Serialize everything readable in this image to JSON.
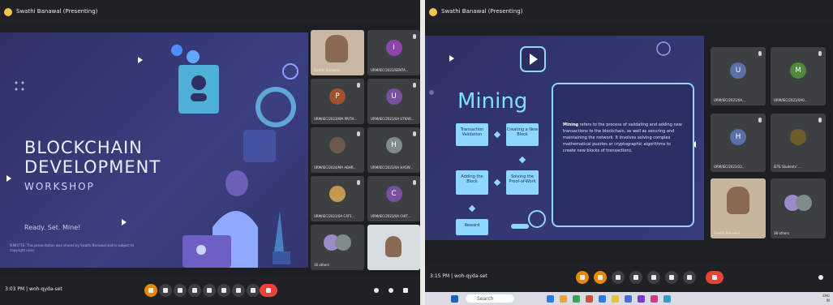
{
  "left": {
    "title": "Swathi Banawal (Presenting)",
    "slide": {
      "title_line1": "BLOCKCHAIN",
      "title_line2": "DEVELOPMENT",
      "title_line3": "WORKSHOP",
      "tagline": "Ready. Set. Mine!",
      "note": "IEMISTTE: This presentation was shared by Swathi Banawal and is subject to copyright rules."
    },
    "tiles": [
      {
        "name": "Swathi Banawal",
        "type": "video"
      },
      {
        "name": "URM/IEC/2023/SENTA...",
        "initial": "I",
        "color": "#8e44ad"
      },
      {
        "name": "URM/IEC/2023/WA PRITH...",
        "initial": "P",
        "color": "#a0522d"
      },
      {
        "name": "URM/IEC/2021/0A UTKAR...",
        "initial": "U",
        "color": "#7b4fa0"
      },
      {
        "name": "URM/IEC/2024/MA ABHR...",
        "type": "photo"
      },
      {
        "name": "URM/IEC/2023/0A HASW...",
        "initial": "H",
        "color": "#7f8c8d"
      },
      {
        "name": "URM/IEC/2021/0A CAT1...",
        "type": "photo2"
      },
      {
        "name": "URM/IEC/2023/0A CHIT...",
        "initial": "C",
        "color": "#7b4fa0"
      },
      {
        "name": "16 others",
        "type": "others"
      },
      {
        "name": "",
        "type": "self"
      }
    ],
    "meeting_time": "3:03 PM",
    "meeting_code": "woh-qyda-set"
  },
  "right": {
    "title": "Swathi Banawal (Presenting)",
    "slide": {
      "title": "Mining",
      "steps": [
        "Transaction Validation",
        "Creating a New Block",
        "Solving the Proof-of-Work",
        "Adding the Block",
        "Reward"
      ],
      "description_bold": "Mining",
      "description": "refers to the process of validating and adding new transactions to the blockchain, as well as securing and maintaining the network. It involves solving complex mathematical puzzles or cryptographic algorithms to create new blocks of transactions."
    },
    "tiles": [
      {
        "name": "URM/IEC/2021/0A...",
        "initial": "U",
        "color": "#5b6fa8"
      },
      {
        "name": "URM/IEC/2021/0A0...",
        "initial": "M",
        "color": "#4e8a3a"
      },
      {
        "name": "URM/IEC/2023/22...",
        "initial": "H",
        "color": "#5b6fa8"
      },
      {
        "name": "IETE Students' ...",
        "type": "logo"
      },
      {
        "name": "Swathi Banawal",
        "type": "video"
      },
      {
        "name": "38 others",
        "type": "others"
      }
    ],
    "meeting_time": "3:15 PM",
    "meeting_code": "woh-qyda-set",
    "search_placeholder": "Search",
    "clock_line1": "ENG",
    "clock_line2": "IN"
  }
}
